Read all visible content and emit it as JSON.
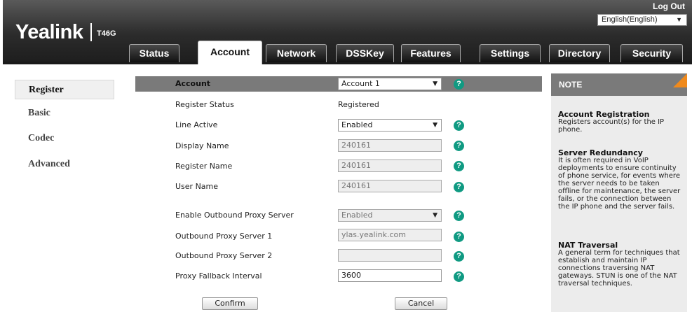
{
  "header": {
    "brand": "Yealink",
    "model": "T46G",
    "logout": "Log Out",
    "language": "English(English)"
  },
  "tabs": [
    {
      "label": "Status",
      "active": false
    },
    {
      "label": "Account",
      "active": true
    },
    {
      "label": "Network",
      "active": false
    },
    {
      "label": "DSSKey",
      "active": false
    },
    {
      "label": "Features",
      "active": false
    },
    {
      "label": "Settings",
      "active": false
    },
    {
      "label": "Directory",
      "active": false
    },
    {
      "label": "Security",
      "active": false
    }
  ],
  "sidebar": {
    "items": [
      {
        "label": "Register",
        "active": true
      },
      {
        "label": "Basic",
        "active": false
      },
      {
        "label": "Codec",
        "active": false
      },
      {
        "label": "Advanced",
        "active": false
      }
    ]
  },
  "form": {
    "account_label": "Account",
    "account_value": "Account 1",
    "register_status_label": "Register Status",
    "register_status_value": "Registered",
    "line_active_label": "Line Active",
    "line_active_value": "Enabled",
    "display_name_label": "Display Name",
    "display_name_value": "240161",
    "register_name_label": "Register Name",
    "register_name_value": "240161",
    "user_name_label": "User Name",
    "user_name_value": "240161",
    "outbound_proxy_label": "Enable Outbound Proxy Server",
    "outbound_proxy_value": "Enabled",
    "proxy1_label": "Outbound Proxy Server 1",
    "proxy1_value": "ylas.yealink.com",
    "proxy2_label": "Outbound Proxy Server 2",
    "proxy2_value": "",
    "fallback_label": "Proxy Fallback Interval",
    "fallback_value": "3600",
    "help_glyph": "?",
    "confirm": "Confirm",
    "cancel": "Cancel"
  },
  "note": {
    "title": "NOTE",
    "sections": [
      {
        "title": "Account Registration",
        "text": "Registers account(s) for the IP phone."
      },
      {
        "title": "Server Redundancy",
        "text": "It is often required in VoIP deployments to ensure continuity of phone service, for events where the server needs to be taken offline for maintenance, the server fails, or the connection between the IP phone and the server fails."
      },
      {
        "title": "NAT Traversal",
        "text": "A general term for techniques that establish and maintain IP connections traversing NAT gateways. STUN is one of the NAT traversal techniques."
      }
    ]
  },
  "colors": {
    "header_dark": "#2c2c2c",
    "help_green": "#0f9a82",
    "note_accent": "#f08a1c",
    "section_grey": "#7a7a7a"
  }
}
